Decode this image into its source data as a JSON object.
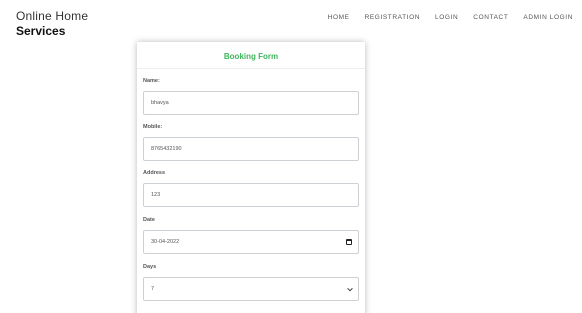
{
  "brand": {
    "line1": "Online Home",
    "line2": "Services"
  },
  "nav": [
    "HOME",
    "REGISTRATION",
    "LOGIN",
    "CONTACT",
    "ADMIN LOGIN"
  ],
  "form": {
    "title": "Booking Form",
    "name_label": "Name:",
    "name_value": "bhavya",
    "mobile_label": "Mobile:",
    "mobile_value": "8765432190",
    "address_label": "Address",
    "address_value": "123",
    "date_label": "Date",
    "date_value": "30-04-2022",
    "days_label": "Days",
    "days_value": "7"
  },
  "colors": {
    "title_green": "#3fb55a"
  },
  "icons": {
    "date": "calendar-icon",
    "days": "chevron-down-icon"
  }
}
